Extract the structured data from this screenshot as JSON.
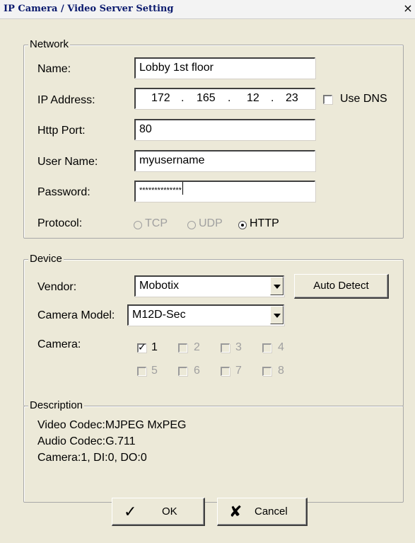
{
  "window": {
    "title": "IP Camera / Video Server Setting",
    "close_glyph": "×",
    "close_icon": "close-icon"
  },
  "network": {
    "legend": "Network",
    "name_label": "Name:",
    "name_value": "Lobby 1st floor",
    "ip_label": "IP Address:",
    "ip_parts": [
      "172",
      "165",
      "12",
      "23"
    ],
    "use_dns_label": "Use DNS",
    "use_dns_checked": false,
    "port_label": "Http Port:",
    "port_value": "80",
    "user_label": "User Name:",
    "user_value": "myusername",
    "password_label": "Password:",
    "password_value": "**************",
    "protocol_label": "Protocol:",
    "protocols": [
      {
        "label": "TCP",
        "selected": false,
        "enabled": false
      },
      {
        "label": "UDP",
        "selected": false,
        "enabled": false
      },
      {
        "label": "HTTP",
        "selected": true,
        "enabled": true
      }
    ]
  },
  "device": {
    "legend": "Device",
    "vendor_label": "Vendor:",
    "vendor_value": "Mobotix",
    "auto_detect_label": "Auto Detect",
    "model_label": "Camera Model:",
    "model_value": "M12D-Sec",
    "camera_label": "Camera:",
    "cameras": [
      {
        "label": "1",
        "checked": true,
        "enabled": true
      },
      {
        "label": "2",
        "checked": false,
        "enabled": false
      },
      {
        "label": "3",
        "checked": false,
        "enabled": false
      },
      {
        "label": "4",
        "checked": false,
        "enabled": false
      },
      {
        "label": "5",
        "checked": false,
        "enabled": false
      },
      {
        "label": "6",
        "checked": false,
        "enabled": false
      },
      {
        "label": "7",
        "checked": false,
        "enabled": false
      },
      {
        "label": "8",
        "checked": false,
        "enabled": false
      }
    ]
  },
  "description": {
    "legend": "Description",
    "lines": [
      "Video Codec:MJPEG MxPEG",
      "Audio Codec:G.711",
      "Camera:1, DI:0, DO:0"
    ]
  },
  "buttons": {
    "ok_label": "OK",
    "ok_icon": "checkmark-icon",
    "cancel_label": "Cancel",
    "cancel_icon": "x-mark-icon"
  }
}
